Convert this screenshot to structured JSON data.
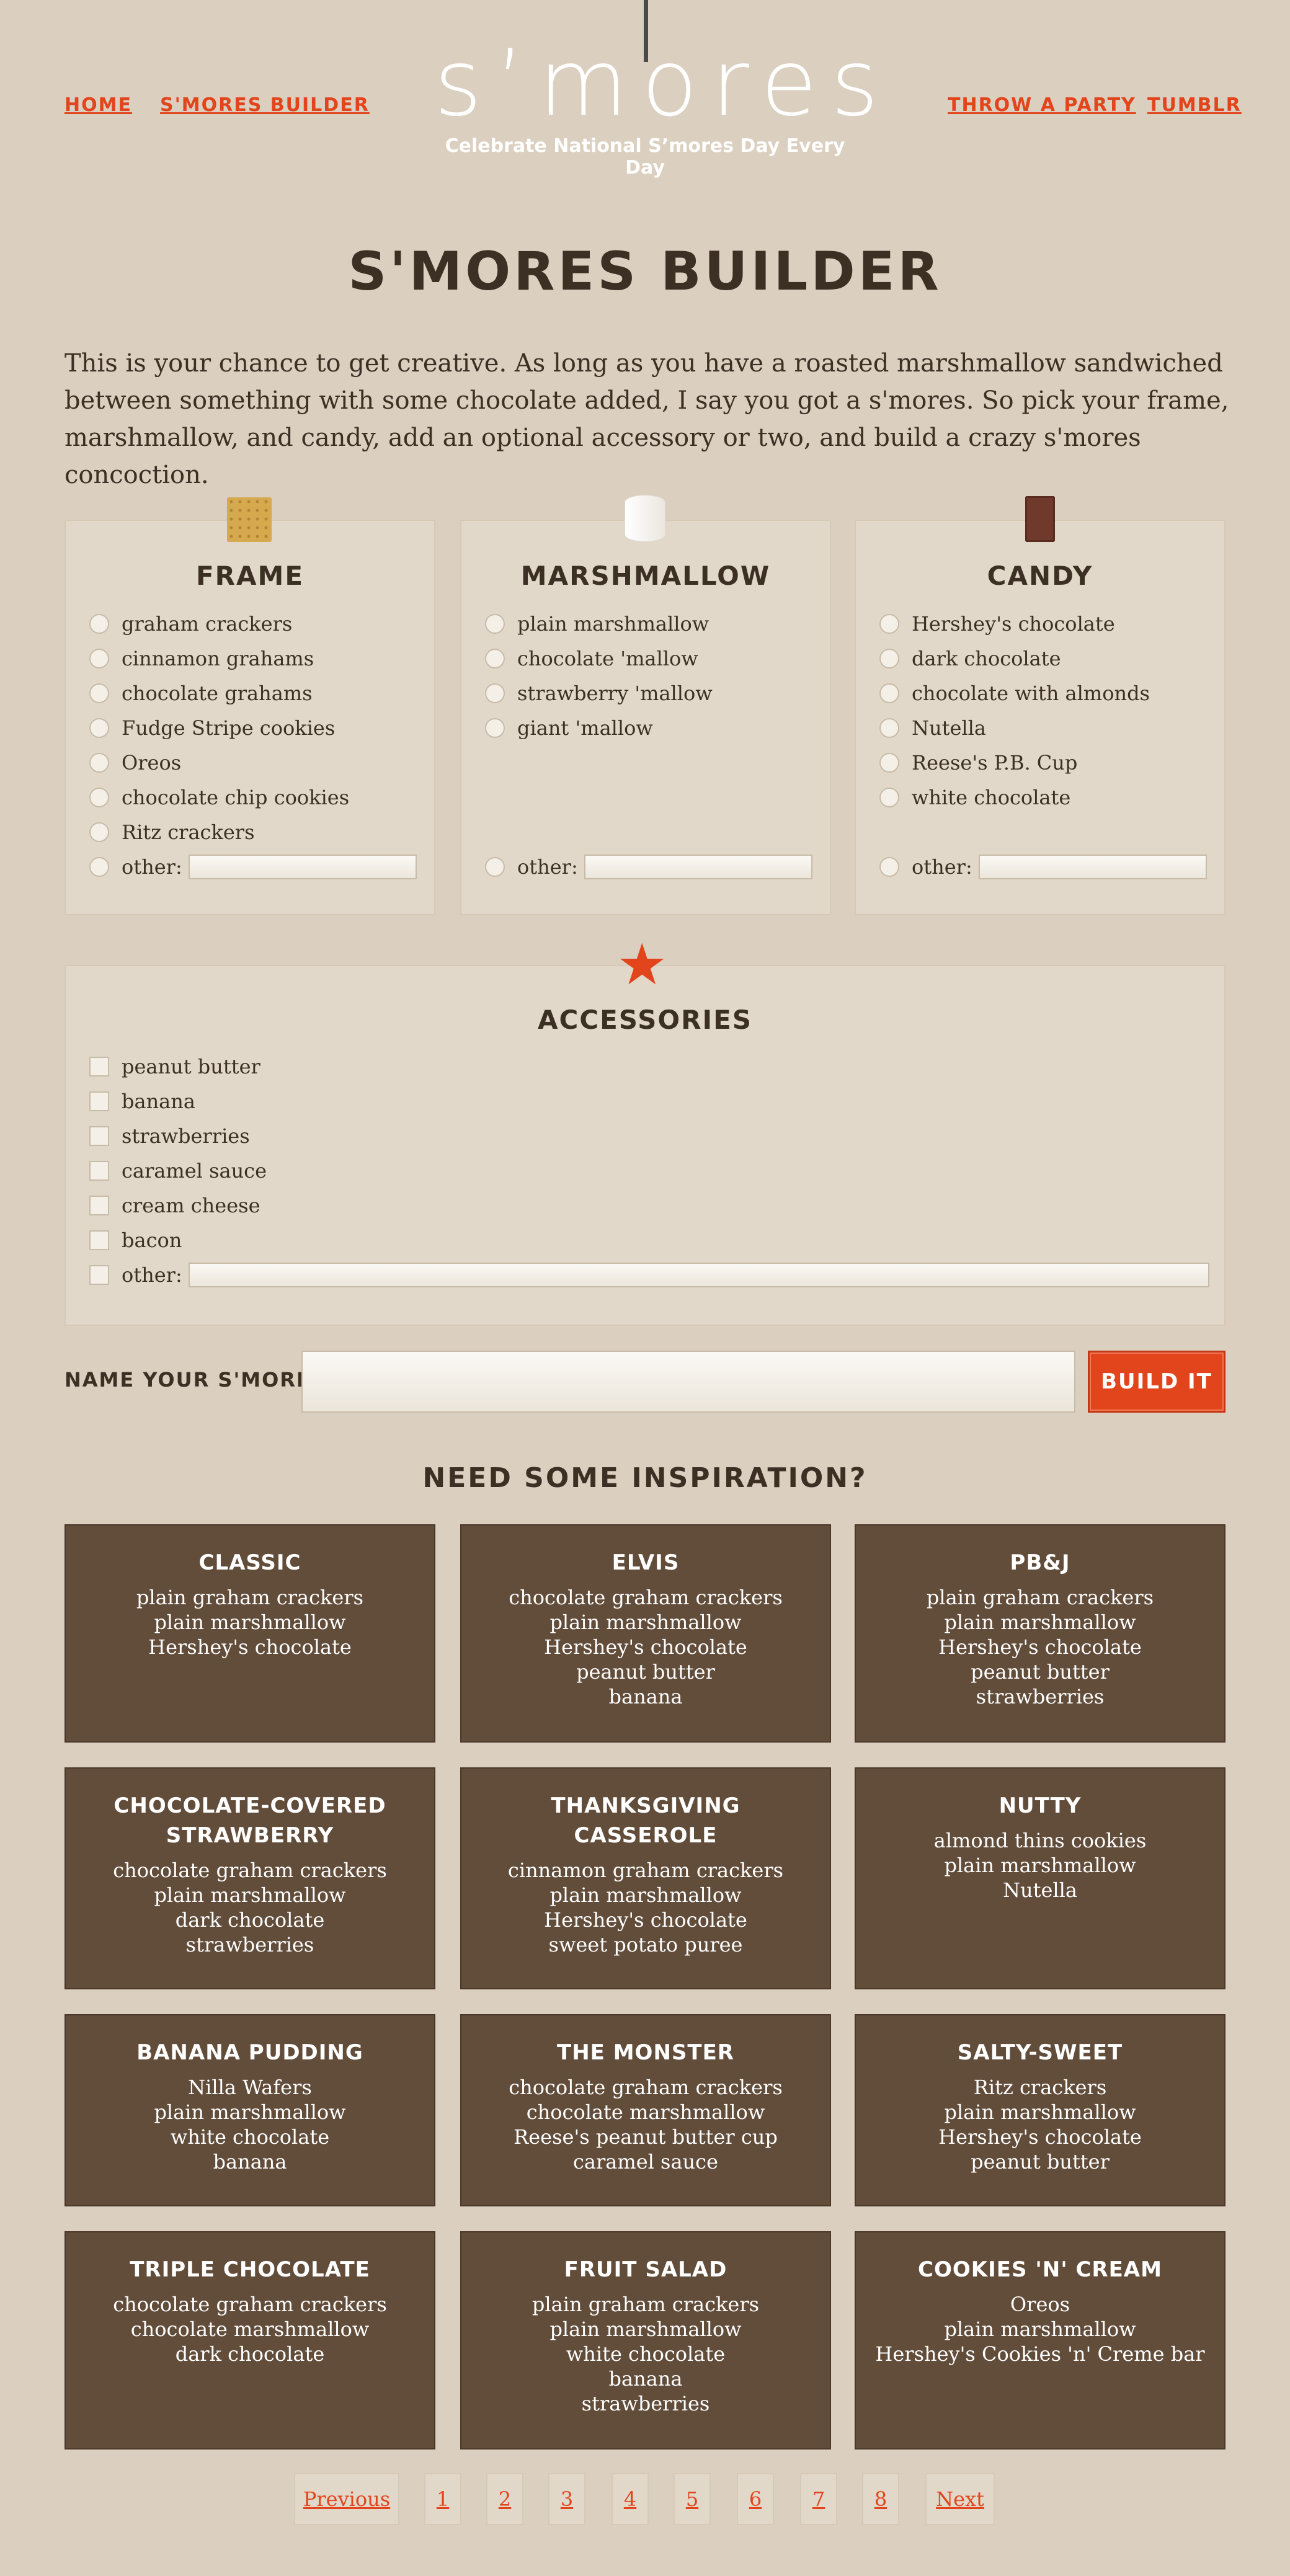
{
  "nav": {
    "home": "HOME",
    "builder": "S'MORES BUILDER",
    "party": "THROW A PARTY",
    "tumblr": "TUMBLR"
  },
  "logo": {
    "text": "s’mores",
    "tagline": "Celebrate National S’mores Day Every Day"
  },
  "page_title": "S'MORES BUILDER",
  "intro": "This is your chance to get creative. As long as you have a roasted marshmallow sandwiched between something with some chocolate added, I say you got a s'mores. So pick your frame, marshmallow, and candy, add an optional accessory or two, and build a crazy s'mores concoction.",
  "frame": {
    "title": "FRAME",
    "icon": "graham-cracker-icon",
    "options": [
      "graham crackers",
      "cinnamon grahams",
      "chocolate grahams",
      "Fudge Stripe cookies",
      "Oreos",
      "chocolate chip cookies",
      "Ritz crackers"
    ],
    "other_label": "other:"
  },
  "marshmallow": {
    "title": "MARSHMALLOW",
    "icon": "marshmallow-icon",
    "options": [
      "plain marshmallow",
      "chocolate 'mallow",
      "strawberry 'mallow",
      "giant 'mallow"
    ],
    "other_label": "other:"
  },
  "candy": {
    "title": "CANDY",
    "icon": "chocolate-bar-icon",
    "options": [
      "Hershey's chocolate",
      "dark chocolate",
      "chocolate with almonds",
      "Nutella",
      "Reese's P.B. Cup",
      "white chocolate"
    ],
    "other_label": "other:"
  },
  "accessories": {
    "title": "ACCESSORIES",
    "icon": "star-icon",
    "options": [
      "peanut butter",
      "banana",
      "strawberries",
      "caramel sauce",
      "cream cheese",
      "bacon"
    ],
    "other_label": "other:"
  },
  "name_row": {
    "label": "NAME YOUR S'MORES:",
    "input_value": "",
    "button": "BUILD IT"
  },
  "inspiration": {
    "title": "NEED SOME INSPIRATION?",
    "cards": [
      {
        "title": "CLASSIC",
        "lines": [
          "plain graham crackers",
          "plain marshmallow",
          "Hershey's chocolate"
        ]
      },
      {
        "title": "ELVIS",
        "lines": [
          "chocolate graham crackers",
          "plain marshmallow",
          "Hershey's chocolate",
          "peanut butter",
          "banana"
        ]
      },
      {
        "title": "PB&J",
        "lines": [
          "plain graham crackers",
          "plain marshmallow",
          "Hershey's chocolate",
          "peanut butter",
          "strawberries"
        ]
      },
      {
        "title": "CHOCOLATE-COVERED STRAWBERRY",
        "lines": [
          "chocolate graham crackers",
          "plain marshmallow",
          "dark chocolate",
          "strawberries"
        ]
      },
      {
        "title": "THANKSGIVING CASSEROLE",
        "lines": [
          "cinnamon graham crackers",
          "plain marshmallow",
          "Hershey's chocolate",
          "sweet potato puree"
        ]
      },
      {
        "title": "NUTTY",
        "lines": [
          "almond thins cookies",
          "plain marshmallow",
          "Nutella"
        ]
      },
      {
        "title": "BANANA PUDDING",
        "lines": [
          "Nilla Wafers",
          "plain marshmallow",
          "white chocolate",
          "banana"
        ]
      },
      {
        "title": "THE MONSTER",
        "lines": [
          "chocolate graham crackers",
          "chocolate marshmallow",
          "Reese's peanut butter cup",
          "caramel sauce"
        ]
      },
      {
        "title": "SALTY-SWEET",
        "lines": [
          "Ritz crackers",
          "plain marshmallow",
          "Hershey's chocolate",
          "peanut butter"
        ]
      },
      {
        "title": "TRIPLE CHOCOLATE",
        "lines": [
          "chocolate graham crackers",
          "chocolate marshmallow",
          "dark chocolate"
        ]
      },
      {
        "title": "FRUIT SALAD",
        "lines": [
          "plain graham crackers",
          "plain marshmallow",
          "white chocolate",
          "banana",
          "strawberries"
        ]
      },
      {
        "title": "COOKIES 'N' CREAM",
        "lines": [
          "Oreos",
          "plain marshmallow",
          "Hershey's Cookies 'n' Creme bar"
        ]
      }
    ]
  },
  "pagination": {
    "previous": "Previous",
    "pages": [
      "1",
      "2",
      "3",
      "4",
      "5",
      "6",
      "7",
      "8"
    ],
    "next": "Next"
  },
  "colors": {
    "background": "#dbcfbf",
    "accent": "#e2441c",
    "card": "#624c3a",
    "text": "#3c2f24"
  }
}
